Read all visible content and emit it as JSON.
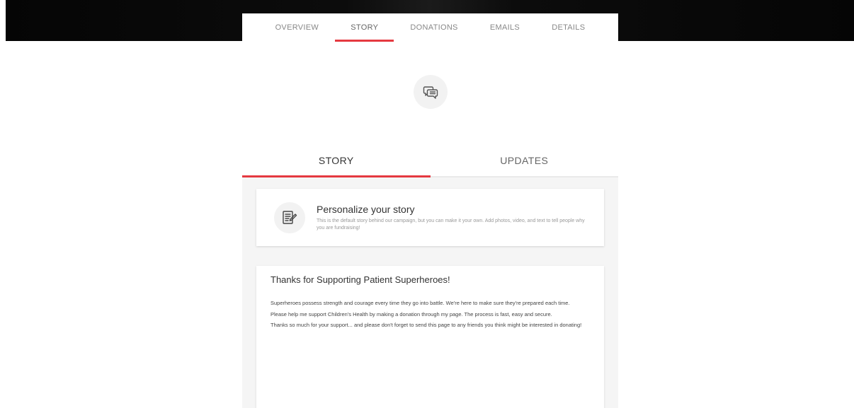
{
  "top_nav": {
    "tabs": [
      {
        "label": "OVERVIEW",
        "active": false
      },
      {
        "label": "STORY",
        "active": true
      },
      {
        "label": "DONATIONS",
        "active": false
      },
      {
        "label": "EMAILS",
        "active": false
      },
      {
        "label": "DETAILS",
        "active": false
      }
    ]
  },
  "section": {
    "icon": "speech-bubbles-icon"
  },
  "sub_tabs": {
    "story": "STORY",
    "updates": "UPDATES",
    "active": "STORY"
  },
  "personalize": {
    "icon": "document-edit-icon",
    "title": "Personalize your story",
    "description": "This is the default story behind our campaign, but you can make it your own. Add photos, video, and text to tell people why you are fundraising!"
  },
  "story": {
    "title": "Thanks for Supporting Patient Superheroes!",
    "paragraphs": [
      "Superheroes possess strength and courage every time they go into battle. We're here to make sure they're prepared each time.",
      "Please help me support Children's Health by making a donation through my page. The process is fast, easy and secure.",
      "Thanks so much for your support... and please don't forget to send this page to any friends you think might be interested in donating!"
    ]
  },
  "colors": {
    "accent": "#e53940",
    "banner": "#0a0a0a",
    "content_bg": "#f5f5f5"
  }
}
